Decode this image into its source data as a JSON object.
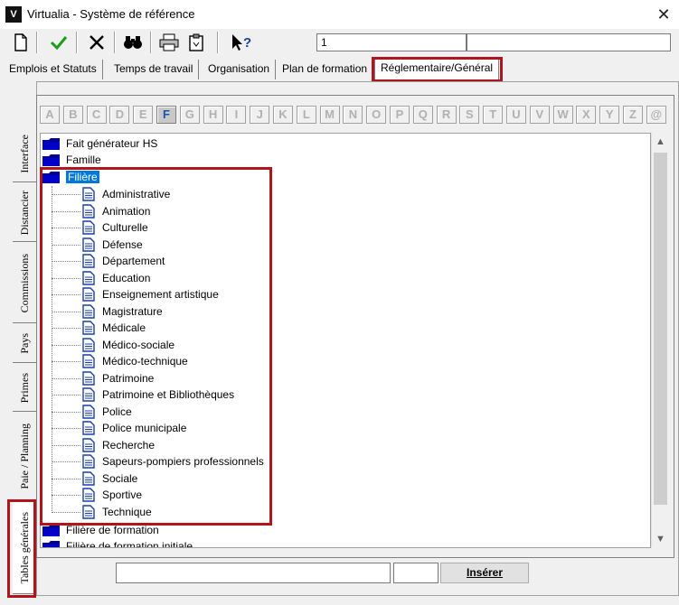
{
  "window": {
    "title": "Virtualia - Système de référence",
    "app_icon": "V"
  },
  "toolbar": {
    "icons": [
      "new-document-icon",
      "checkmark-icon",
      "delete-x-icon",
      "binoculars-icon",
      "printer-icon",
      "clipboard-icon",
      "help-arrow-icon"
    ],
    "field_value": "1",
    "colors": {
      "check": "#1a9e1a",
      "highlight": "#b0141c"
    }
  },
  "top_tabs": [
    "Emplois et Statuts",
    "Temps de travail",
    "Organisation",
    "Plan de formation",
    "Réglementaire/Général"
  ],
  "side_tabs": [
    "Interface",
    "Distancier",
    "Commissions",
    "Pays",
    "Primes",
    "Paie / Planning",
    "Tables générales"
  ],
  "letters": [
    "A",
    "B",
    "C",
    "D",
    "E",
    "F",
    "G",
    "H",
    "I",
    "J",
    "K",
    "L",
    "M",
    "N",
    "O",
    "P",
    "Q",
    "R",
    "S",
    "T",
    "U",
    "V",
    "W",
    "X",
    "Y",
    "Z",
    "@"
  ],
  "active_letter": "F",
  "tree": {
    "top_items": [
      "Fait générateur HS",
      "Famille",
      "Filière"
    ],
    "children": [
      "Administrative",
      "Animation",
      "Culturelle",
      "Défense",
      "Département",
      "Education",
      "Enseignement artistique",
      "Magistrature",
      "Médicale",
      "Médico-sociale",
      "Médico-technique",
      "Patrimoine",
      "Patrimoine et Bibliothèques",
      "Police",
      "Police municipale",
      "Recherche",
      "Sapeurs-pompiers professionnels",
      "Sociale",
      "Sportive",
      "Technique"
    ],
    "bottom_items": [
      "Filière de formation",
      "Filière de formation initiale"
    ]
  },
  "bottom": {
    "insert_label": "Insérer"
  }
}
